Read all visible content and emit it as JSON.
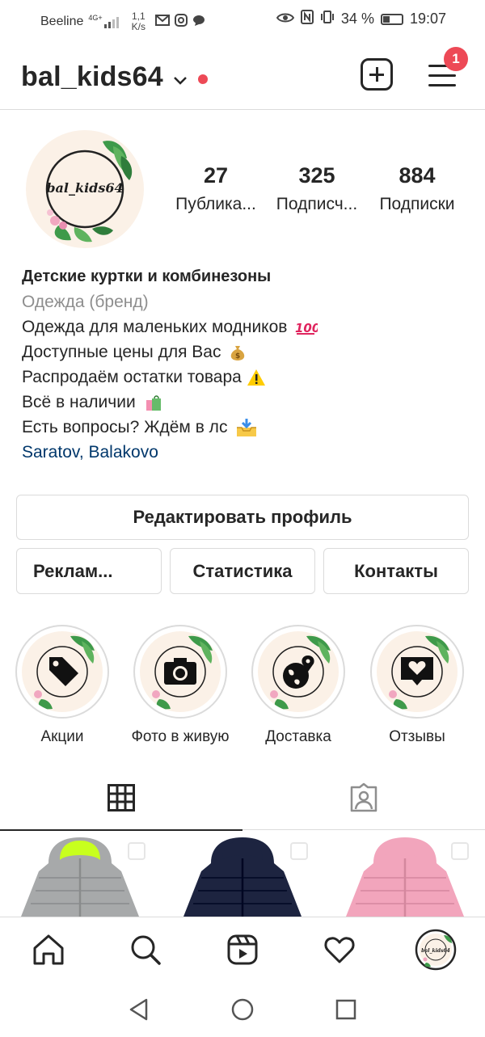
{
  "status_bar": {
    "carrier": "Beeline",
    "net_type": "4G+",
    "speed_value": "1,1",
    "speed_unit": "K/s",
    "battery": "34 %",
    "time": "19:07"
  },
  "header": {
    "username": "bal_kids64",
    "notification_count": "1"
  },
  "profile": {
    "avatar_text": "bal_kids64",
    "stats": [
      {
        "value": "27",
        "label": "Публика..."
      },
      {
        "value": "325",
        "label": "Подписч..."
      },
      {
        "value": "884",
        "label": "Подписки"
      }
    ],
    "bio": {
      "name": "Детские куртки и комбинезоны",
      "category": "Одежда (бренд)",
      "lines": [
        "Одежда для маленьких модников",
        "Доступные цены для Вас",
        "Распродаём остатки товара",
        "Всё в наличии",
        "Есть вопросы? Ждём в лс"
      ],
      "location": "Saratov, Balakovo"
    }
  },
  "buttons": {
    "edit_profile": "Редактировать профиль",
    "promotions": "Реклам...",
    "insights": "Статистика",
    "contacts": "Контакты"
  },
  "highlights": [
    {
      "label": "Акции",
      "icon": "tag-icon"
    },
    {
      "label": "Фото в живую",
      "icon": "camera-icon"
    },
    {
      "label": "Доставка",
      "icon": "globe-pin-icon"
    },
    {
      "label": "Отзывы",
      "icon": "heart-message-icon"
    }
  ],
  "tabs": [
    {
      "name": "grid-icon",
      "active": true
    },
    {
      "name": "tagged-icon",
      "active": false
    }
  ],
  "posts": [
    {
      "jacket_color": "#a7a9aa",
      "accent": "#c8ff1e"
    },
    {
      "jacket_color": "#1d2440",
      "accent": "#1d2440"
    },
    {
      "jacket_color": "#f2a5bc",
      "accent": "#f2a5bc"
    }
  ],
  "colors": {
    "accent_red": "#ed4956",
    "link_blue": "#00376b",
    "muted_gray": "#8e8e8e",
    "border_gray": "#dbdbdb"
  }
}
